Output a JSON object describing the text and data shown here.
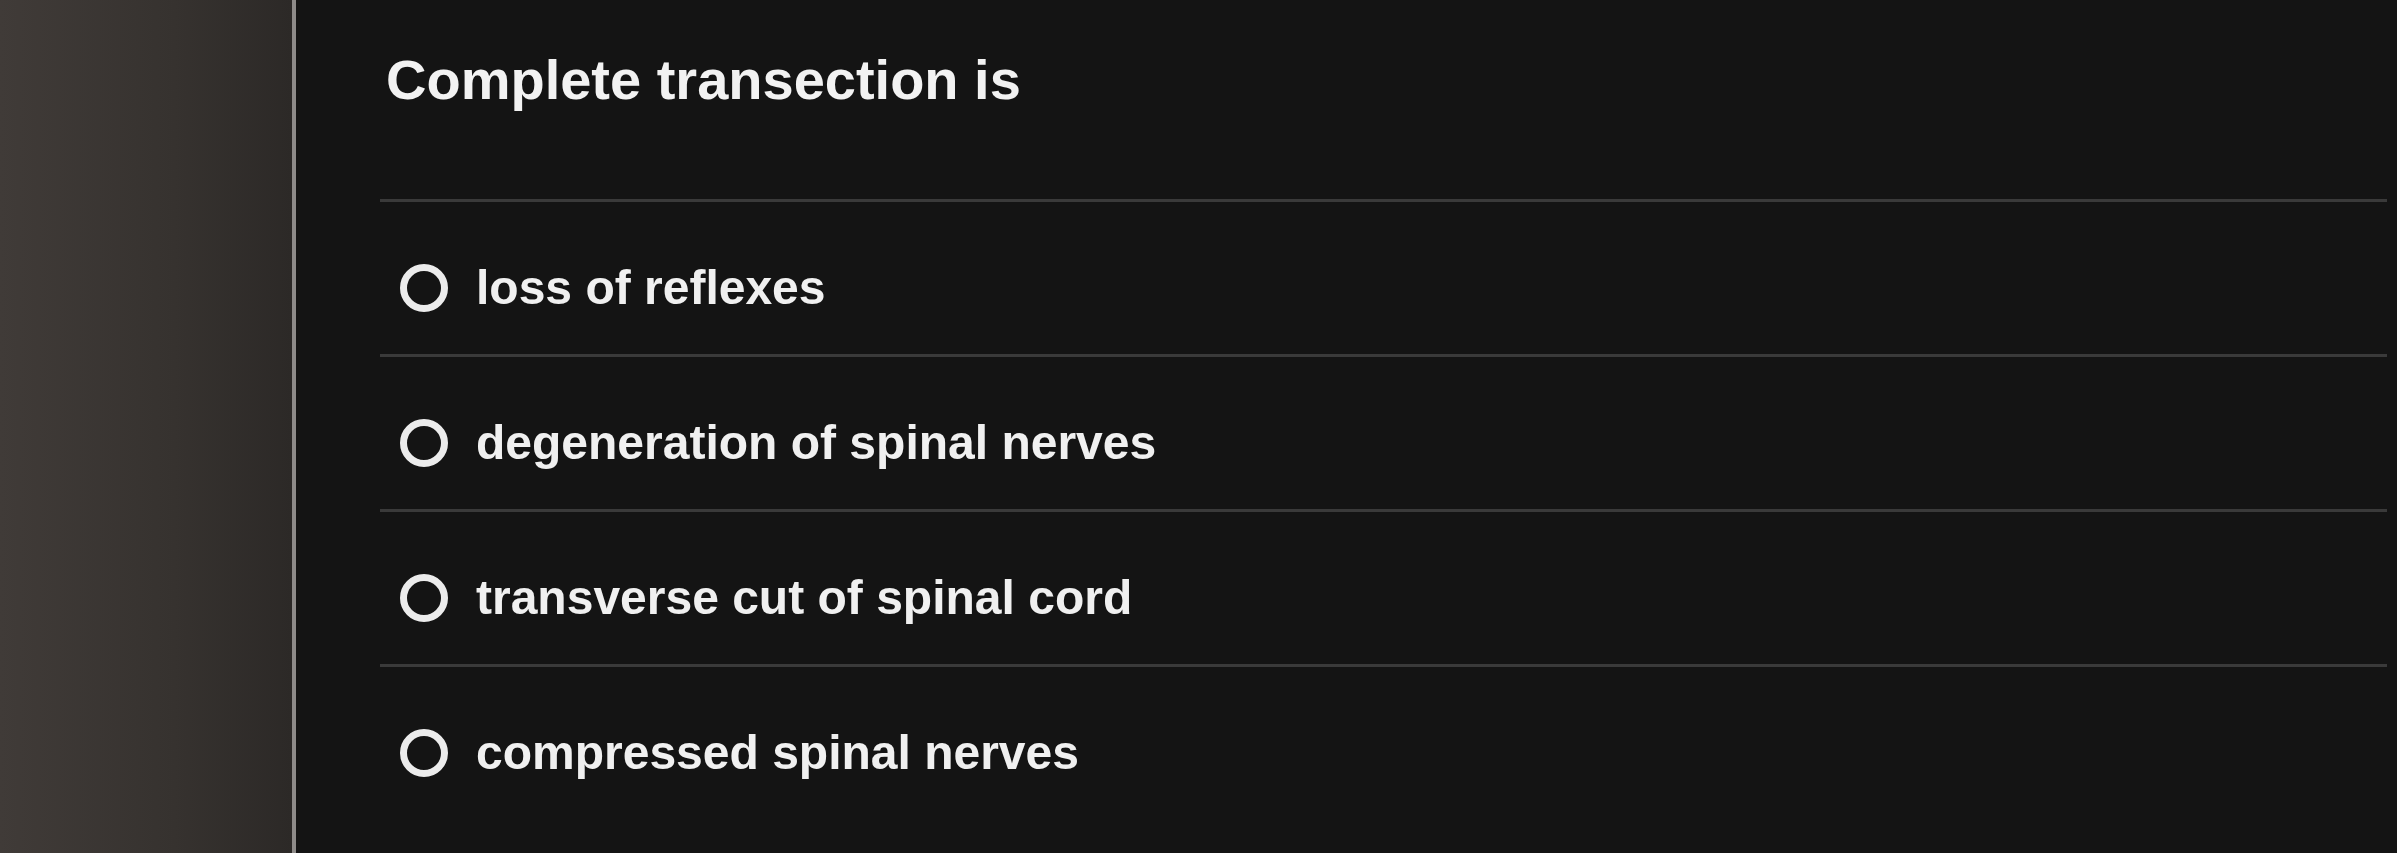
{
  "question": {
    "text": "Complete transection is"
  },
  "options": [
    {
      "label": "loss of reflexes",
      "selected": false
    },
    {
      "label": "degeneration of spinal nerves",
      "selected": false
    },
    {
      "label": "transverse cut of spinal cord",
      "selected": false
    },
    {
      "label": "compressed spinal nerves",
      "selected": false
    }
  ]
}
